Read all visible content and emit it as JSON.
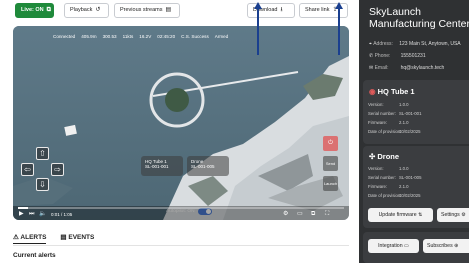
{
  "toolbar": {
    "live_label": "Live: ON",
    "playback_label": "Playback",
    "previous_streams_label": "Previous streams",
    "download_label": "Download",
    "share_link_label": "Share link"
  },
  "telemetry": {
    "connection": "Connected",
    "altitude": "405.9m",
    "frequency": "300.53",
    "speed": "11kts",
    "voltage": "16.2V",
    "time": "02:45:20",
    "cs": "C.S. Success",
    "armed": "Armed"
  },
  "video": {
    "progress": 0.03,
    "time_display": "0:01 / 1:05",
    "autopilot_label": "Autopilot: ON",
    "hq_tube_name": "HQ Tube 1",
    "hq_tube_serial": "SL-001-001",
    "drone_name": "Drone",
    "drone_serial": "SL-001-005",
    "side_send_label": "Send",
    "side_launch_label": "Launch"
  },
  "tabs": {
    "alerts": "ALERTS",
    "events": "EVENTS"
  },
  "alerts_section_title": "Current alerts",
  "center": {
    "name_line1": "SkyLaunch",
    "name_line2": "Manufacturing Center",
    "address_label": "Address:",
    "address_value": "123 Main St, Anytown, USA",
    "phone_label": "Phone:",
    "phone_value": "155501231",
    "email_label": "Email:",
    "email_value": "hq@skylaunch.tech"
  },
  "hq_tube_card": {
    "title": "HQ Tube 1",
    "version_label": "Version:",
    "version_value": "1.0.0",
    "serial_label": "Serial number:",
    "serial_value": "SL-001-001",
    "firmware_label": "Firmware:",
    "firmware_value": "2.1.0",
    "provision_label": "Date of provision:",
    "provision_value": "10/02/2025"
  },
  "drone_card": {
    "title": "Drone",
    "version_label": "Version:",
    "version_value": "1.0.0",
    "serial_label": "Serial number:",
    "serial_value": "SL-001-005",
    "firmware_label": "Firmware:",
    "firmware_value": "2.1.0",
    "provision_label": "Date of provision:",
    "provision_value": "10/02/2025",
    "update_button": "Update firmware",
    "settings_button": "Settings"
  },
  "bottom_buttons": {
    "integration": "Integration",
    "subscribes": "Subscribes"
  },
  "colors": {
    "live_green": "#1f8a3b",
    "panel_dark": "#2f3133",
    "annotation_arrow": "#1a3f8f",
    "toggle_blue": "#4a7bd6",
    "alert_red": "#e05a5a"
  }
}
